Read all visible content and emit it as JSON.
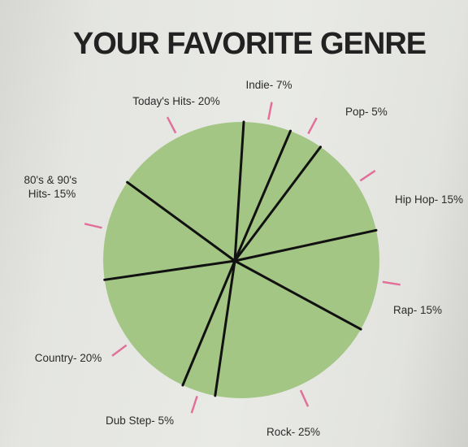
{
  "title": "YOUR FAVORITE GENRE",
  "chart_data": {
    "type": "pie",
    "title": "YOUR FAVORITE GENRE",
    "slices": [
      {
        "label": "Indie",
        "value": 7,
        "text": "Indie- 7%"
      },
      {
        "label": "Pop",
        "value": 5,
        "text": "Pop- 5%"
      },
      {
        "label": "Hip Hop",
        "value": 15,
        "text": "Hip Hop- 15%"
      },
      {
        "label": "Rap",
        "value": 15,
        "text": "Rap- 15%"
      },
      {
        "label": "Rock",
        "value": 25,
        "text": "Rock- 25%"
      },
      {
        "label": "Dub Step",
        "value": 5,
        "text": "Dub Step- 5%"
      },
      {
        "label": "Country",
        "value": 20,
        "text": "Country- 20%"
      },
      {
        "label": "80's & 90's Hits",
        "value": 15,
        "text": "80's & 90's Hits- 15%"
      },
      {
        "label": "Today's Hits",
        "value": 20,
        "text": "Today's Hits- 20%"
      }
    ],
    "legend": "none",
    "colors": {
      "fill": "#a3c685",
      "divider": "#111111",
      "leader": "#e2709a"
    }
  }
}
